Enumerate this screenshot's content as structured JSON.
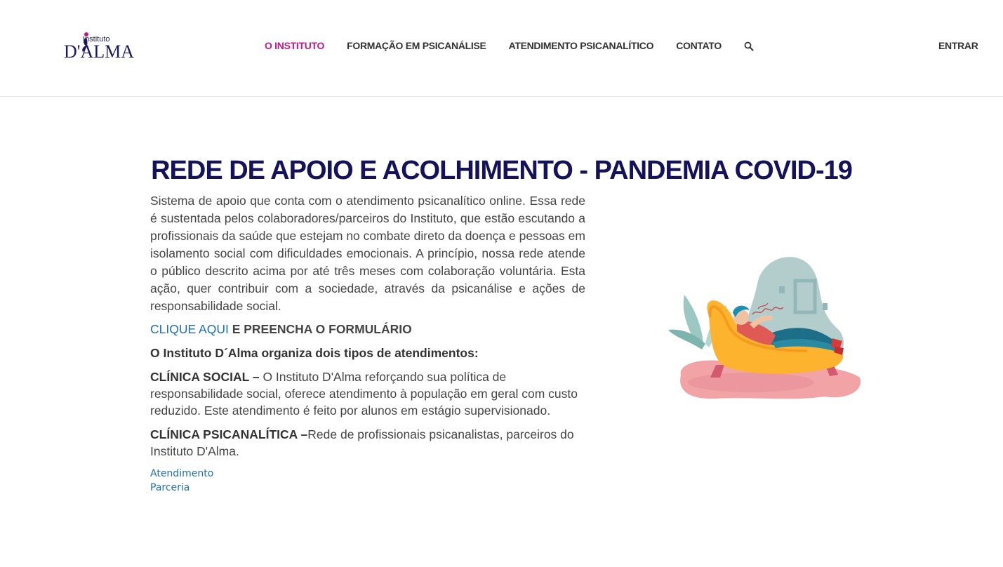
{
  "logo": {
    "small": "Instituto",
    "big": "D'ALMA"
  },
  "nav": {
    "items": [
      {
        "label": "O INSTITUTO"
      },
      {
        "label": "FORMAÇÃO EM PSICANÁLISE"
      },
      {
        "label": "ATENDIMENTO PSICANALÍTICO"
      },
      {
        "label": "CONTATO"
      }
    ],
    "search_icon": "search-icon",
    "login": "ENTRAR"
  },
  "page": {
    "title": "REDE DE APOIO E ACOLHIMENTO - PANDEMIA COVID-19",
    "intro": "Sistema de apoio que conta com o atendimento psicanalítico online. Essa rede é sustentada pelos colaboradores/parceiros do Instituto, que estão escutando a profissionais da saúde que estejam no combate direto da doença e pessoas em isolamento social com dificuldades emocionais. A princípio, nossa rede atende o público descrito acima por até três meses com colaboração voluntária. Esta ação, quer contribuir com a sociedade, através da psicanálise e ações de responsabilidade social.",
    "cta_link": "CLIQUE AQUI",
    "cta_rest": " E PREENCHA O FORMULÁRIO",
    "subhead": "O Instituto D´Alma organiza dois tipos de atendimentos:",
    "social_title": "CLÍNICA SOCIAL –",
    "social_text": " O Instituto D'Alma reforçando sua política de responsabilidade social, oferece atendimento à população em geral com custo reduzido. Este atendimento é feito por alunos em estágio supervisionado.",
    "psy_title": "CLÍNICA PSICANALÍTICA –",
    "psy_text": "Rede de profissionais psicanalistas, parceiros do Instituto D'Alma.",
    "tags": [
      "Atendimento",
      "Parceria"
    ]
  },
  "colors": {
    "accent": "#c2188a",
    "title": "#15125c",
    "link": "#1f6fb5"
  }
}
